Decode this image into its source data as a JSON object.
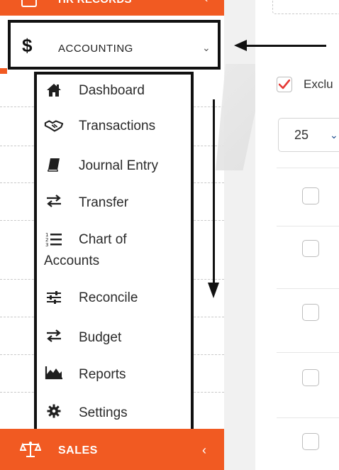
{
  "sidebar": {
    "top_item": {
      "label": "HR RECORDS"
    },
    "accounting": {
      "symbol": "$",
      "label": "ACCOUNTING",
      "chevron": "⌄"
    },
    "menu": [
      {
        "icon": "home-icon",
        "label": "Dashboard"
      },
      {
        "icon": "handshake-icon",
        "label": "Transactions"
      },
      {
        "icon": "book-icon",
        "label": "Journal Entry"
      },
      {
        "icon": "transfer-arrows-icon",
        "label": "Transfer"
      },
      {
        "icon": "numbered-list-icon",
        "label": "Chart of",
        "label_line2": "Accounts"
      },
      {
        "icon": "sliders-icon",
        "label": "Reconcile"
      },
      {
        "icon": "transfer-arrows-icon",
        "label": "Budget"
      },
      {
        "icon": "area-chart-icon",
        "label": "Reports"
      },
      {
        "icon": "gear-icon",
        "label": "Settings"
      }
    ],
    "sales": {
      "icon": "scale-icon",
      "label": "SALES",
      "chevron": "‹"
    },
    "top_chevron": "‹"
  },
  "main": {
    "exclude_label": "Exclu",
    "exclude_checked": true,
    "page_size": {
      "value": "25",
      "caret": "⌄"
    }
  },
  "colors": {
    "accent": "#f15a22",
    "check_mark": "#e53935",
    "caret": "#1a4b8c",
    "annotation": "#111111"
  }
}
